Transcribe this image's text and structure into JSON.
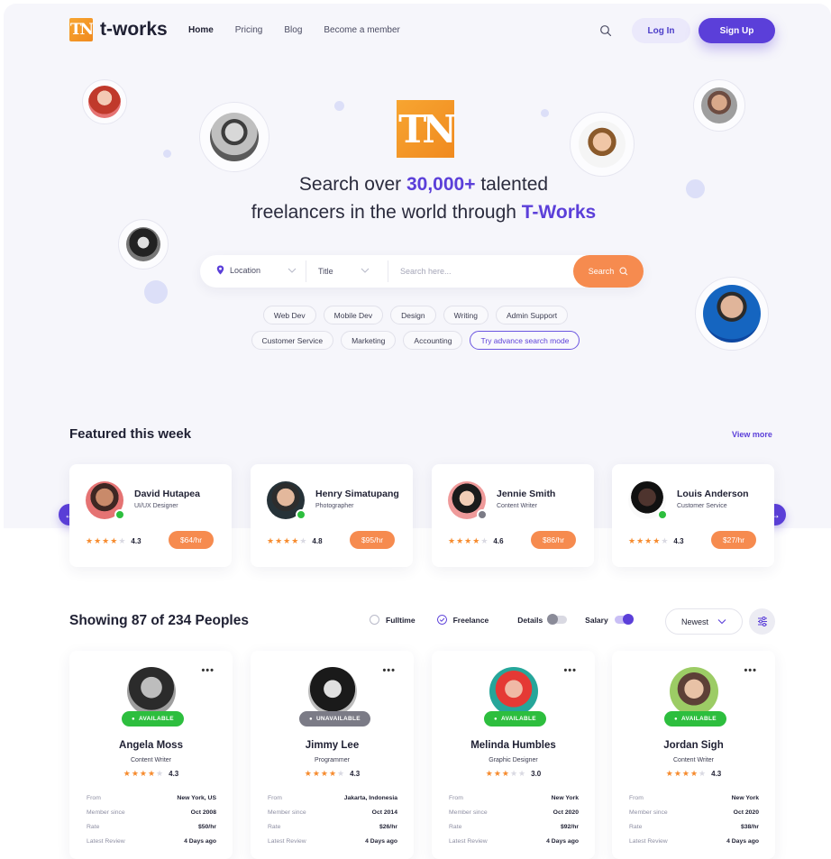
{
  "brand": {
    "name": "t-works",
    "mark": "TN"
  },
  "nav": {
    "items": [
      "Home",
      "Pricing",
      "Blog",
      "Become a member"
    ],
    "login": "Log In",
    "signup": "Sign Up"
  },
  "hero": {
    "line1_pre": "Search over ",
    "line1_hl": "30,000+",
    "line1_post": " talented",
    "line2_pre": "freelancers in the world through ",
    "line2_hl": "T-Works"
  },
  "search": {
    "location": "Location",
    "title": "Title",
    "placeholder": "Search here...",
    "button": "Search"
  },
  "tags_row1": [
    "Web Dev",
    "Mobile Dev",
    "Design",
    "Writing",
    "Admin Support"
  ],
  "tags_row2": [
    "Customer Service",
    "Marketing",
    "Accounting"
  ],
  "advanced_search": "Try advance search mode",
  "featured": {
    "title": "Featured this week",
    "view_more": "View more",
    "cards": [
      {
        "name": "David Hutapea",
        "role": "UI/UX Designer",
        "rating": "4.3",
        "stars": 4,
        "rate": "$64/hr",
        "online": true
      },
      {
        "name": "Henry Simatupang",
        "role": "Photographer",
        "rating": "4.8",
        "stars": 4,
        "rate": "$95/hr",
        "online": true
      },
      {
        "name": "Jennie Smith",
        "role": "Content Writer",
        "rating": "4.6",
        "stars": 4,
        "rate": "$86/hr",
        "online": false
      },
      {
        "name": "Louis Anderson",
        "role": "Customer Service",
        "rating": "4.3",
        "stars": 4,
        "rate": "$27/hr",
        "online": true
      }
    ]
  },
  "listing": {
    "title": "Showing 87 of 234 Peoples",
    "filters": {
      "fulltime": "Fulltime",
      "freelance": "Freelance",
      "details": "Details",
      "salary": "Salary"
    },
    "sort": "Newest",
    "labels": {
      "from": "From",
      "member_since": "Member since",
      "rate": "Rate",
      "latest_review": "Latest Review"
    },
    "people": [
      {
        "name": "Angela Moss",
        "role": "Content Writer",
        "rating": "4.3",
        "stars": 4,
        "status": "AVAILABLE",
        "available": true,
        "from": "New York, US",
        "member_since": "Oct 2008",
        "rate": "$50/hr",
        "latest_review": "4 Days ago"
      },
      {
        "name": "Jimmy Lee",
        "role": "Programmer",
        "rating": "4.3",
        "stars": 4,
        "status": "UNAVAILABLE",
        "available": false,
        "from": "Jakarta, Indonesia",
        "member_since": "Oct 2014",
        "rate": "$26/hr",
        "latest_review": "4 Days ago"
      },
      {
        "name": "Melinda Humbles",
        "role": "Graphic Designer",
        "rating": "3.0",
        "stars": 3,
        "status": "AVAILABLE",
        "available": true,
        "from": "New York",
        "member_since": "Oct 2020",
        "rate": "$92/hr",
        "latest_review": "4 Days ago"
      },
      {
        "name": "Jordan Sigh",
        "role": "Content Writer",
        "rating": "4.3",
        "stars": 4,
        "status": "AVAILABLE",
        "available": true,
        "from": "New York",
        "member_since": "Oct 2020",
        "rate": "$38/hr",
        "latest_review": "4 Days ago"
      }
    ]
  },
  "colors": {
    "primary": "#5b3fd9",
    "accent": "#f68b4f",
    "online": "#2dbe3e",
    "offline": "#7b7b86"
  }
}
